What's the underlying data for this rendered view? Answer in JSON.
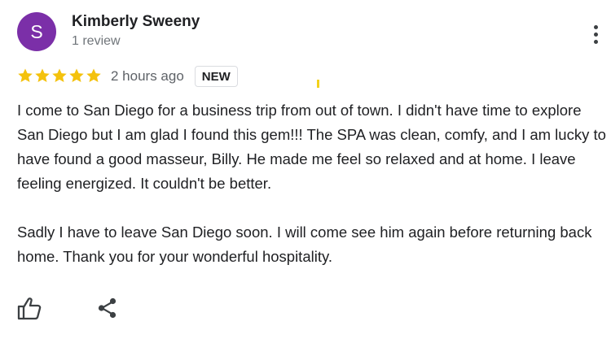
{
  "review": {
    "author": {
      "initial": "S",
      "name": "Kimberly Sweeny",
      "review_count": "1 review",
      "avatar_color": "#7b2fa8"
    },
    "rating": 5,
    "rating_max": 5,
    "star_color": "#f4c20d",
    "time_ago": "2 hours ago",
    "badge": "NEW",
    "paragraphs": [
      "I come to San Diego for a business trip from out of town. I didn't have time to explore San Diego but I am glad I found this gem!!! The SPA was clean, comfy, and I am lucky to have found a good masseur, Billy. He made me feel so relaxed and at home. I leave feeling energized. It couldn't be better.",
      "Sadly I have to leave San Diego soon. I will come see him again before returning back home. Thank you for your wonderful hospitality."
    ]
  },
  "actions": {
    "more_icon": "more-vert-icon",
    "like_icon": "thumb-up-icon",
    "share_icon": "share-icon"
  }
}
